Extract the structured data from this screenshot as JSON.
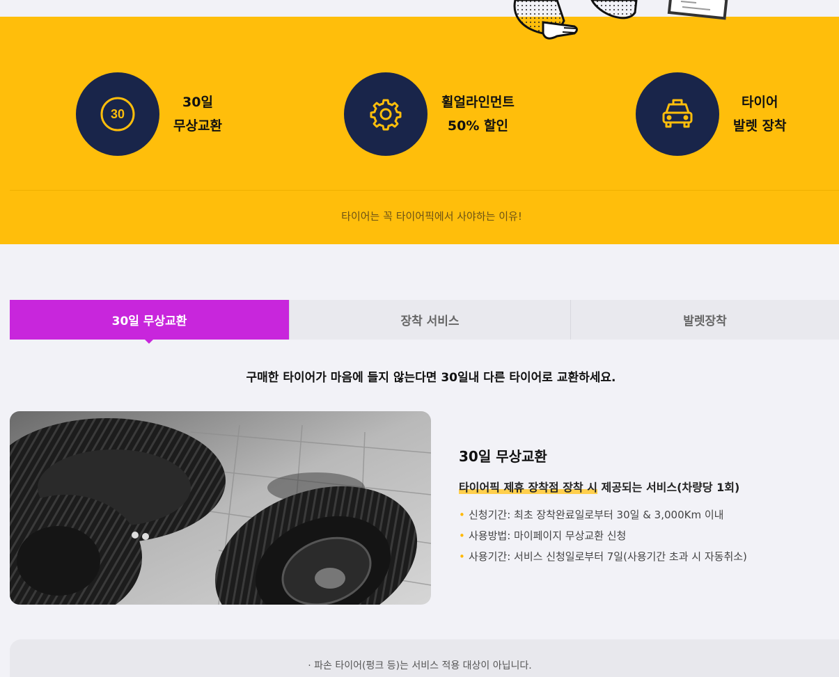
{
  "features": [
    {
      "icon": "badge-30-icon",
      "badge": "30",
      "line1": "30일",
      "line2": "무상교환"
    },
    {
      "icon": "gear-icon",
      "line1": "휠얼라인먼트",
      "line2": "50% 할인"
    },
    {
      "icon": "taxi-icon",
      "line1": "타이어",
      "line2": "발렛 장착"
    }
  ],
  "why_text": "타이어는 꼭 타이어픽에서 사야하는 이유!",
  "tabs": [
    {
      "label": "30일 무상교환",
      "active": true
    },
    {
      "label": "장착 서비스",
      "active": false
    },
    {
      "label": "발렛장착",
      "active": false
    }
  ],
  "lead": "구매한 타이어가 마음에 들지 않는다면 30일내 다른 타이어로 교환하세요.",
  "info": {
    "title": "30일 무상교환",
    "highlight": "타이어픽 제휴 장착점 장착 시",
    "subtitle_rest": " 제공되는 서비스(차량당 1회)",
    "bullets": [
      "신청기간: 최초 장착완료일로부터 30일 & 3,000Km 이내",
      "사용방법: 마이페이지 무상교환 신청",
      "사용기간: 서비스 신청일로부터 7일(사용기간 초과 시 자동취소)"
    ]
  },
  "notice": "· 파손 타이어(펑크 등)는 서비스 적용 대상이 아닙니다.",
  "colors": {
    "yellow": "#ffbe0b",
    "navy": "#19254a",
    "accent": "#c826dc",
    "highlight": "#ffcf4d"
  }
}
